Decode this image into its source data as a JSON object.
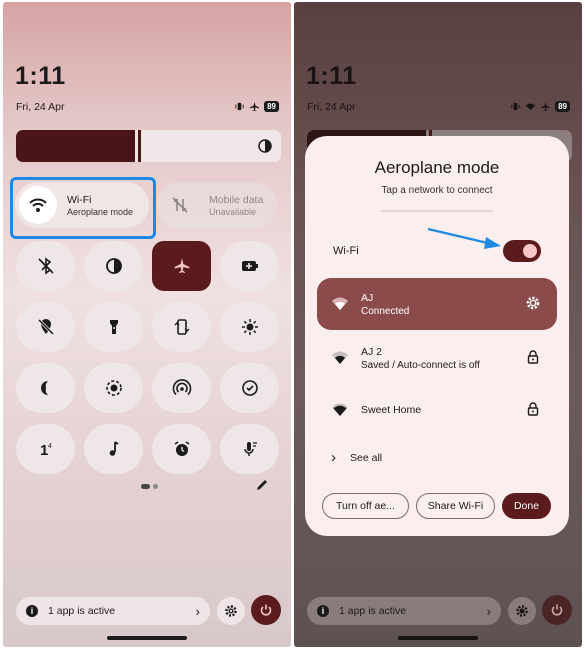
{
  "status": {
    "time": "1:11",
    "date": "Fri, 24 Apr",
    "battery": "89",
    "icons": [
      "vibrate-icon",
      "aeroplane-icon"
    ],
    "icons_right": [
      "vibrate-icon",
      "wifi-icon",
      "aeroplane-icon"
    ]
  },
  "brightness": {
    "level_percent": 45,
    "icon": "auto-brightness-icon"
  },
  "tiles": {
    "wifi": {
      "title": "Wi-Fi",
      "subtitle": "Aeroplane mode",
      "icon": "wifi-icon",
      "active": true
    },
    "mobile": {
      "title": "Mobile data",
      "subtitle": "Unavailable",
      "icon": "mobile-data-off-icon",
      "active": false
    }
  },
  "quick_settings": [
    {
      "name": "bluetooth-off-icon",
      "active": false
    },
    {
      "name": "dark-theme-icon",
      "active": false
    },
    {
      "name": "aeroplane-mode-icon",
      "active": true
    },
    {
      "name": "battery-saver-icon",
      "active": false
    },
    {
      "name": "location-off-icon",
      "active": false
    },
    {
      "name": "torch-icon",
      "active": false
    },
    {
      "name": "auto-rotate-icon",
      "active": false
    },
    {
      "name": "extra-dim-icon",
      "active": false
    },
    {
      "name": "bedtime-icon",
      "active": false
    },
    {
      "name": "screen-record-icon",
      "active": false
    },
    {
      "name": "hotspot-icon",
      "active": false
    },
    {
      "name": "data-saver-icon",
      "active": false
    },
    {
      "name": "nfc-icon",
      "active": false
    },
    {
      "name": "media-output-icon",
      "active": false
    },
    {
      "name": "alarm-icon",
      "active": false
    },
    {
      "name": "live-caption-icon",
      "active": false
    }
  ],
  "footer": {
    "active_apps": "1 app is active"
  },
  "dialog": {
    "title": "Aeroplane mode",
    "subtitle": "Tap a network to connect",
    "wifi_label": "Wi-Fi",
    "wifi_enabled": true,
    "networks": [
      {
        "name": "AJ",
        "status": "Connected",
        "trailing": "gear-icon",
        "selected": true
      },
      {
        "name": "AJ 2",
        "status": "Saved / Auto-connect is off",
        "trailing": "lock-icon",
        "selected": false
      },
      {
        "name": "Sweet Home",
        "status": "",
        "trailing": "lock-icon",
        "selected": false
      }
    ],
    "see_all": "See all",
    "buttons": {
      "turn_off": "Turn off ae...",
      "share": "Share Wi-Fi",
      "done": "Done"
    }
  },
  "colors": {
    "accent": "#5b1b1c",
    "highlight": "#1e88e5",
    "arrow": "#1e88e5",
    "selected_row": "#8c4b4b"
  }
}
